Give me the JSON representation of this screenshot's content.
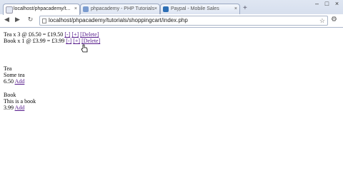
{
  "browser": {
    "tabs": [
      {
        "title": "localhost/phpacademy/t...",
        "active": true
      },
      {
        "title": "phpacademy - PHP Tutorials",
        "active": false
      },
      {
        "title": "Paypal - Mobile Sales",
        "active": false
      }
    ],
    "new_tab_label": "+",
    "window": {
      "minimize": "–",
      "maximize": "□",
      "close": "×"
    },
    "nav": {
      "back": "◀",
      "forward": "▶",
      "reload": "↻"
    },
    "url": "localhost/phpacademy/tutorials/shoppingcart/index.php",
    "colors": {
      "tab_active": "#ffffff",
      "chrome": "#cfd9ea"
    }
  },
  "cart": {
    "items": [
      {
        "text": "Tea x 3 @ £6.50 = £19.50",
        "minus": "[-]",
        "plus": "[+]",
        "delete": "[Delete]"
      },
      {
        "text": "Book x 1 @ £3.99 = £3.99",
        "minus": "[-]",
        "plus": "[+]",
        "delete": "[Delete]"
      }
    ]
  },
  "products": [
    {
      "name": "Tea",
      "description": "Some tea",
      "price": "6.50",
      "add": "Add"
    },
    {
      "name": "Book",
      "description": "This is a book",
      "price": "3.99",
      "add": "Add"
    }
  ]
}
